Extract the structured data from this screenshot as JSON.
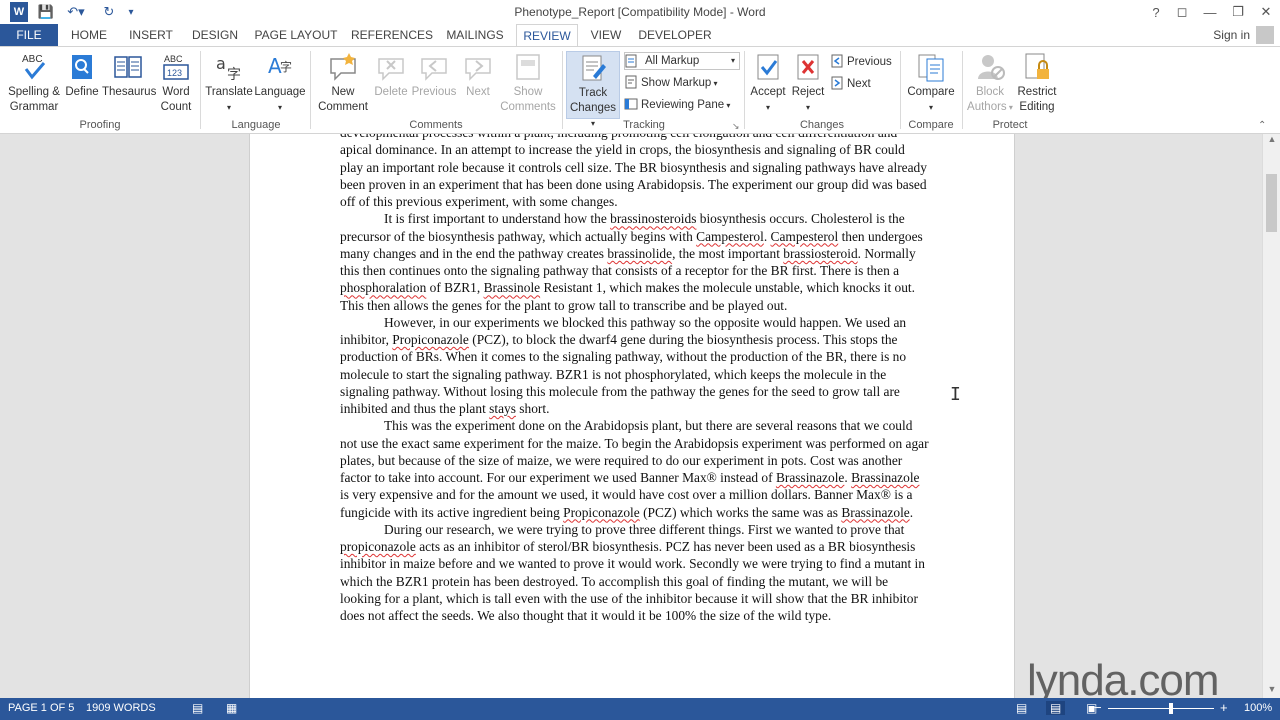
{
  "window": {
    "title": "Phenotype_Report [Compatibility Mode] - Word"
  },
  "tabs": [
    {
      "label": "FILE"
    },
    {
      "label": "HOME"
    },
    {
      "label": "INSERT"
    },
    {
      "label": "DESIGN"
    },
    {
      "label": "PAGE LAYOUT"
    },
    {
      "label": "REFERENCES"
    },
    {
      "label": "MAILINGS"
    },
    {
      "label": "REVIEW"
    },
    {
      "label": "VIEW"
    },
    {
      "label": "DEVELOPER"
    }
  ],
  "account": {
    "signin": "Sign in"
  },
  "ribbon": {
    "proofing": {
      "spelling": "Spelling &",
      "grammar": "Grammar",
      "define": "Define",
      "thesaurus": "Thesaurus",
      "word": "Word",
      "count": "Count",
      "label": "Proofing"
    },
    "language": {
      "translate": "Translate",
      "language": "Language",
      "label": "Language"
    },
    "comments": {
      "new1": "New",
      "new2": "Comment",
      "delete": "Delete",
      "previous": "Previous",
      "next": "Next",
      "show1": "Show",
      "show2": "Comments",
      "label": "Comments"
    },
    "tracking": {
      "track1": "Track",
      "track2": "Changes",
      "all_markup": "All Markup",
      "show_markup": "Show Markup",
      "reviewing_pane": "Reviewing Pane",
      "label": "Tracking"
    },
    "changes": {
      "accept": "Accept",
      "reject": "Reject",
      "previous": "Previous",
      "next": "Next",
      "label": "Changes"
    },
    "compare": {
      "compare": "Compare",
      "label": "Compare"
    },
    "protect": {
      "block1": "Block",
      "block2": "Authors",
      "restrict1": "Restrict",
      "restrict2": "Editing",
      "label": "Protect"
    }
  },
  "document": {
    "paragraphs": [
      {
        "indent": false,
        "html": "developmental processes within a plant, including promoting cell elongation and cell differentiation and apical dominance.  In an attempt to increase the yield in crops, the biosynthesis and signaling of BR could play an important role because it controls cell size. The BR biosynthesis and signaling pathways have already been proven in an experiment that has been done using Arabidopsis.  The experiment our group did was based off of this previous experiment, with some changes."
      },
      {
        "indent": true,
        "html": "It is first important to understand how the brassinosteroids biosynthesis occurs. Cholesterol is the precursor of the biosynthesis pathway, which actually begins with Campesterol.  Campesterol then undergoes many changes and in the end the pathway creates brassinolide, the most important brassiosteroid.  Normally this then continues onto the signaling pathway that consists of a receptor for the BR first.  There is then a phosphoralation of BZR1, Brassinole Resistant 1, which makes the molecule unstable, which knocks it out.  This then allows the genes for the plant to grow tall to transcribe and be played out."
      },
      {
        "indent": true,
        "html": "However, in our experiments we blocked this pathway so the opposite would happen. We used an inhibitor, Propiconazole (PCZ), to block the dwarf4 gene during the biosynthesis process. This stops the production of BRs.  When it comes to the signaling pathway, without the production of the BR, there is no molecule to start the signaling pathway.  BZR1 is not phosphorylated, which keeps the molecule in the signaling pathway.  Without losing this molecule from the pathway the genes for the seed to grow tall are inhibited and thus the plant stays short."
      },
      {
        "indent": true,
        "html": "This was the experiment done on the Arabidopsis plant, but there are several reasons that we could not use the exact same experiment for the maize.  To begin the Arabidopsis experiment was performed on agar plates, but because of the size of maize, we were required to do our experiment in pots.  Cost was another factor to take into account.  For our experiment we used Banner Max® instead of Brassinazole.  Brassinazole is very expensive and for the amount we used, it would have cost over a million dollars.  Banner Max® is a fungicide with its active ingredient being Propiconazole (PCZ) which works the same was as Brassinazole."
      },
      {
        "indent": true,
        "html": "During our research, we were trying to prove three different things. First we wanted to prove that propiconazole acts as an inhibitor of sterol/BR biosynthesis.  PCZ has never been used as a BR biosynthesis inhibitor in maize before and we wanted to prove it would work.  Secondly we were trying to find a mutant in which the BZR1 protein has been destroyed. To accomplish this goal of finding the mutant, we will be looking for a plant, which is tall even with the use of the inhibitor because it will show that the BR inhibitor does not affect the seeds.  We also thought that it would it be 100% the size of the wild type."
      }
    ]
  },
  "status": {
    "page": "PAGE 1 OF 5",
    "words": "1909 WORDS",
    "zoom": "100%",
    "zoom_level": 1.0
  },
  "watermark": "lynda.com",
  "colors": {
    "accent": "#2b579a",
    "squiggle": "#dd3333"
  }
}
